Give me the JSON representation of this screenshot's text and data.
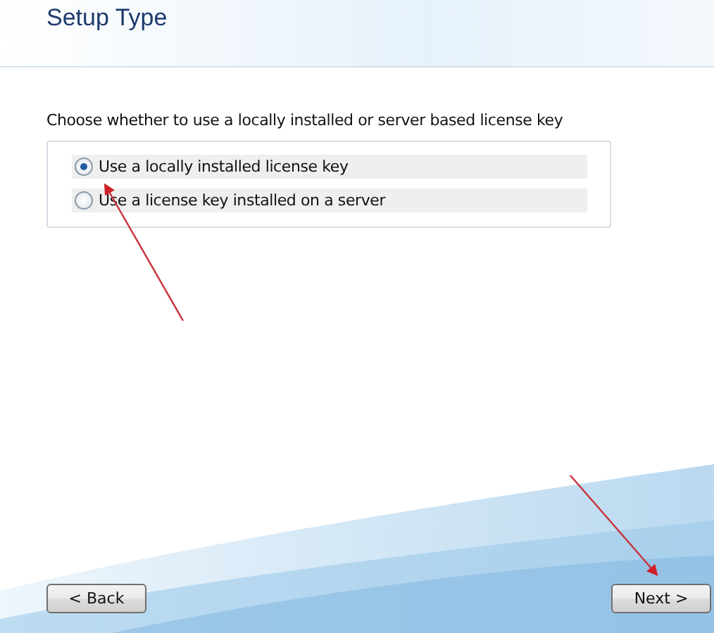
{
  "window": {
    "title": "Setup Type"
  },
  "prompt": "Choose whether to use a locally installed or server based license key",
  "options": [
    {
      "label": "Use a locally installed license key",
      "selected": true
    },
    {
      "label": "Use a license key installed on a server",
      "selected": false
    }
  ],
  "buttons": {
    "back": "< Back",
    "next": "Next >"
  }
}
